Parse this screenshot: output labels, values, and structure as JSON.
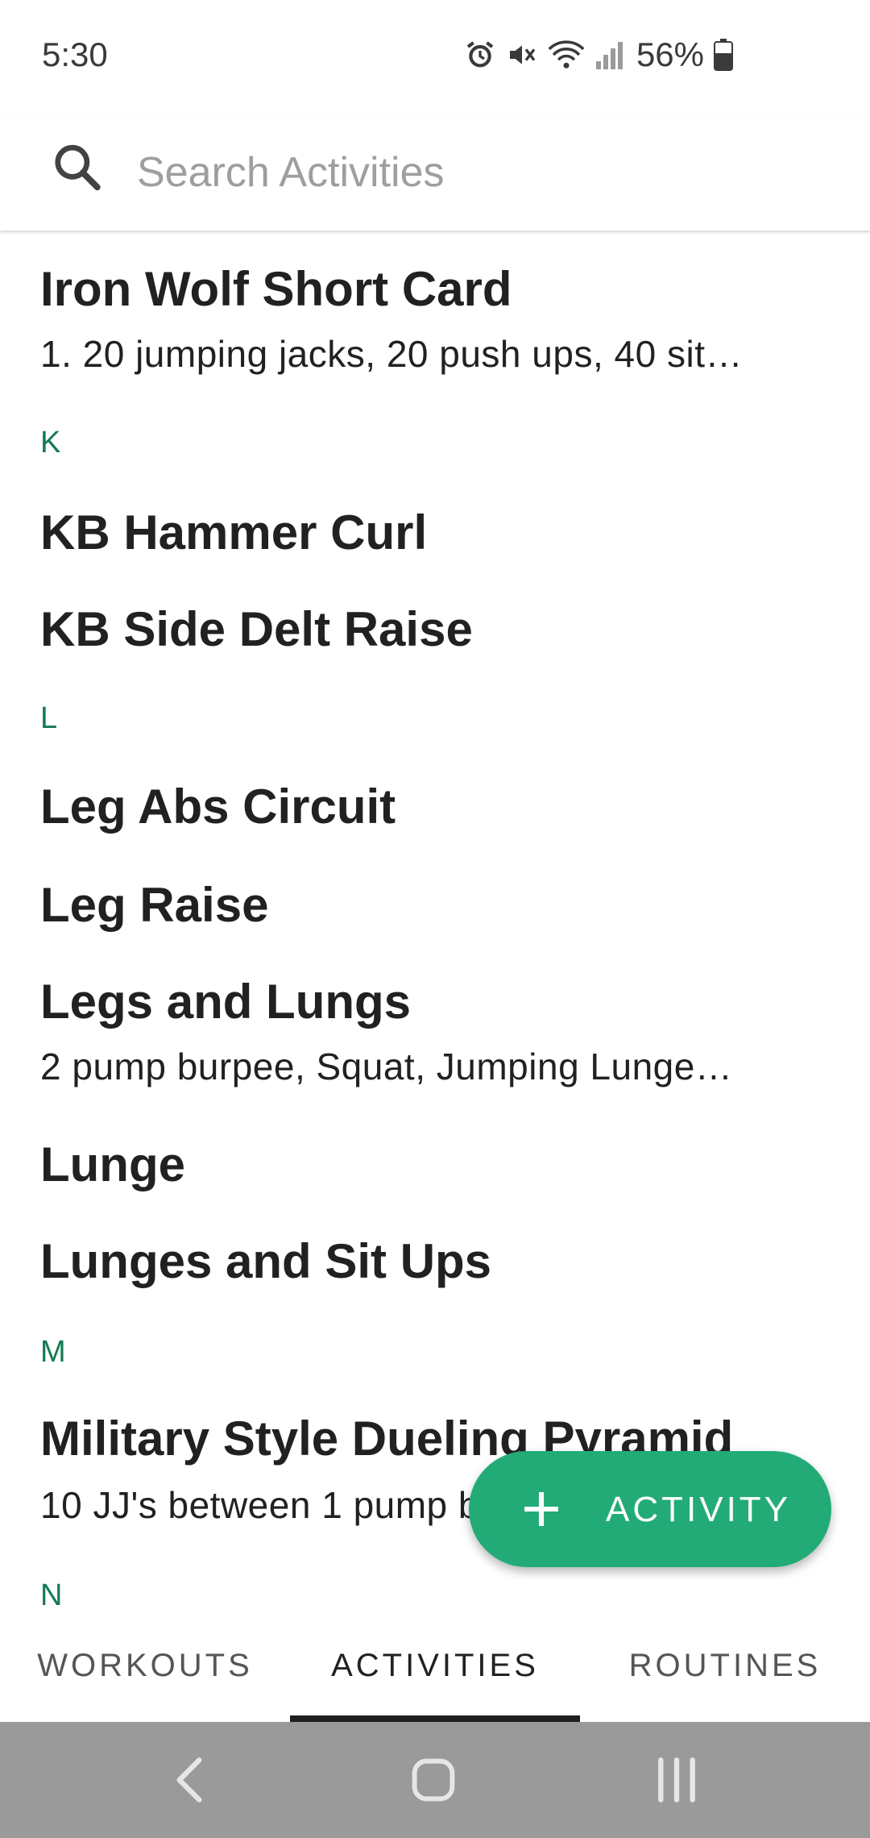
{
  "status_bar": {
    "time": "5:30",
    "battery_percent": "56%",
    "icons": [
      "alarm-icon",
      "mute-icon",
      "wifi-icon",
      "signal-icon",
      "battery-icon"
    ]
  },
  "search": {
    "placeholder": "Search Activities",
    "value": ""
  },
  "list": [
    {
      "kind": "item",
      "title": "Iron Wolf Short Card",
      "subtitle": "1. 20 jumping jacks, 20 push ups, 40 sit…"
    },
    {
      "kind": "section",
      "letter": "K"
    },
    {
      "kind": "item",
      "title": "KB Hammer Curl"
    },
    {
      "kind": "item",
      "title": "KB Side Delt Raise"
    },
    {
      "kind": "section",
      "letter": "L"
    },
    {
      "kind": "item",
      "title": "Leg Abs Circuit"
    },
    {
      "kind": "item",
      "title": "Leg Raise"
    },
    {
      "kind": "item",
      "title": "Legs and Lungs",
      "subtitle": "2 pump burpee, Squat, Jumping Lunge…"
    },
    {
      "kind": "item",
      "title": "Lunge"
    },
    {
      "kind": "item",
      "title": "Lunges and Sit Ups"
    },
    {
      "kind": "section",
      "letter": "M"
    },
    {
      "kind": "item",
      "title": "Military Style Dueling Pyramid",
      "subtitle": "10 JJ's between 1 pump burpee"
    },
    {
      "kind": "section",
      "letter": "N"
    }
  ],
  "fab": {
    "label": "ACTIVITY",
    "icon": "plus-icon"
  },
  "tabs": [
    {
      "label": "WORKOUTS",
      "active": false
    },
    {
      "label": "ACTIVITIES",
      "active": true
    },
    {
      "label": "ROUTINES",
      "active": false
    }
  ],
  "system_nav": [
    "back-icon",
    "home-icon",
    "recents-icon"
  ],
  "colors": {
    "accent": "#22ab77",
    "section_letter": "#137a52",
    "nav_bar": "#9a9a9a",
    "tab_indicator": "#1f1f1f"
  }
}
